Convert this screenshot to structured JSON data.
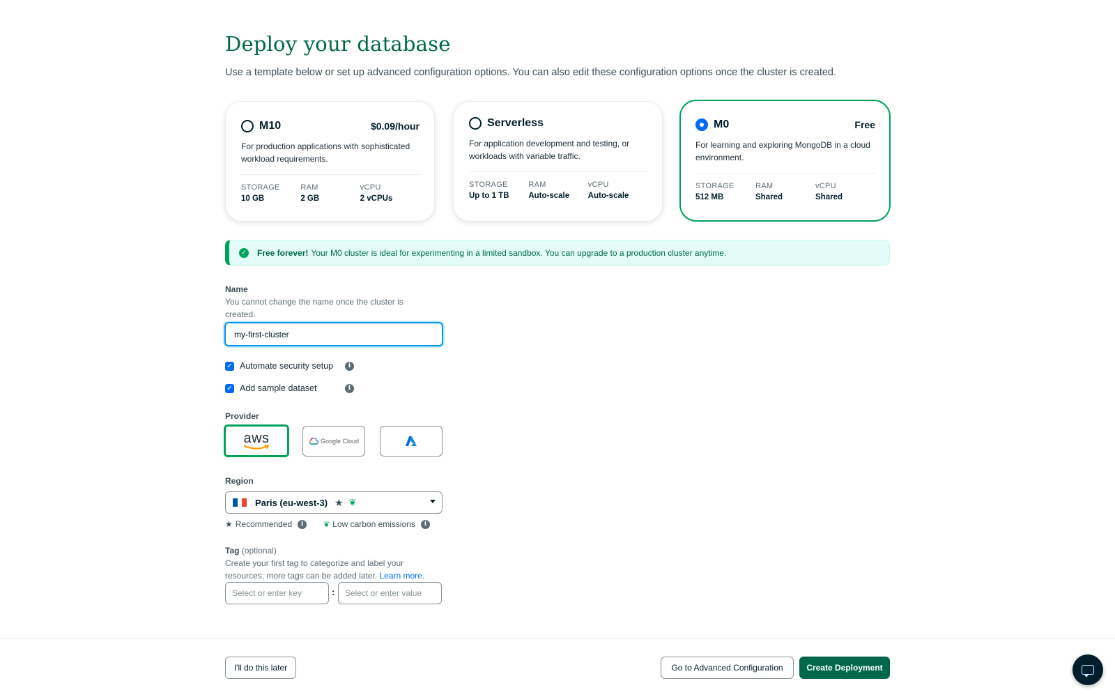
{
  "page": {
    "title": "Deploy your database",
    "subtitle": "Use a template below or set up advanced configuration options. You can also edit these configuration options once the cluster is created."
  },
  "tiers": [
    {
      "name": "M10",
      "price": "$0.09/hour",
      "description": "For production applications with sophisticated workload requirements.",
      "selected": false,
      "specs": [
        {
          "label": "STORAGE",
          "value": "10 GB"
        },
        {
          "label": "RAM",
          "value": "2 GB"
        },
        {
          "label": "vCPU",
          "value": "2 vCPUs"
        }
      ]
    },
    {
      "name": "Serverless",
      "price": "",
      "description": "For application development and testing, or workloads with variable traffic.",
      "selected": false,
      "specs": [
        {
          "label": "STORAGE",
          "value": "Up to 1 TB"
        },
        {
          "label": "RAM",
          "value": "Auto-scale"
        },
        {
          "label": "vCPU",
          "value": "Auto-scale"
        }
      ]
    },
    {
      "name": "M0",
      "price": "Free",
      "description": "For learning and exploring MongoDB in a cloud environment.",
      "selected": true,
      "specs": [
        {
          "label": "STORAGE",
          "value": "512 MB"
        },
        {
          "label": "RAM",
          "value": "Shared"
        },
        {
          "label": "vCPU",
          "value": "Shared"
        }
      ]
    }
  ],
  "banner": {
    "strong": "Free forever!",
    "text": "Your M0 cluster is ideal for experimenting in a limited sandbox. You can upgrade to a production cluster anytime."
  },
  "name_field": {
    "label": "Name",
    "help": "You cannot change the name once the cluster is created.",
    "value": "my-first-cluster"
  },
  "options": [
    {
      "label": "Automate security setup",
      "checked": true
    },
    {
      "label": "Add sample dataset",
      "checked": true
    }
  ],
  "provider": {
    "label": "Provider",
    "items": [
      {
        "name": "aws",
        "selected": true
      },
      {
        "name": "Google Cloud",
        "selected": false
      },
      {
        "name": "Azure",
        "selected": false
      }
    ]
  },
  "region": {
    "label": "Region",
    "value": "Paris (eu-west-3)",
    "legend_recommended": "Recommended",
    "legend_low_carbon": "Low carbon emissions"
  },
  "tag": {
    "label": "Tag",
    "optional": "(optional)",
    "help": "Create your first tag to categorize and label your resources; more tags can be added later.",
    "link": "Learn more.",
    "key_placeholder": "Select or enter key",
    "value_placeholder": "Select or enter value",
    "separator": ":"
  },
  "footer": {
    "later": "I'll do this later",
    "advanced": "Go to Advanced Configuration",
    "create": "Create Deployment"
  },
  "colors": {
    "brand_green": "#00684a",
    "accent_green": "#00a35c",
    "focus_blue": "#0498ec",
    "radio_blue": "#016bf8"
  }
}
